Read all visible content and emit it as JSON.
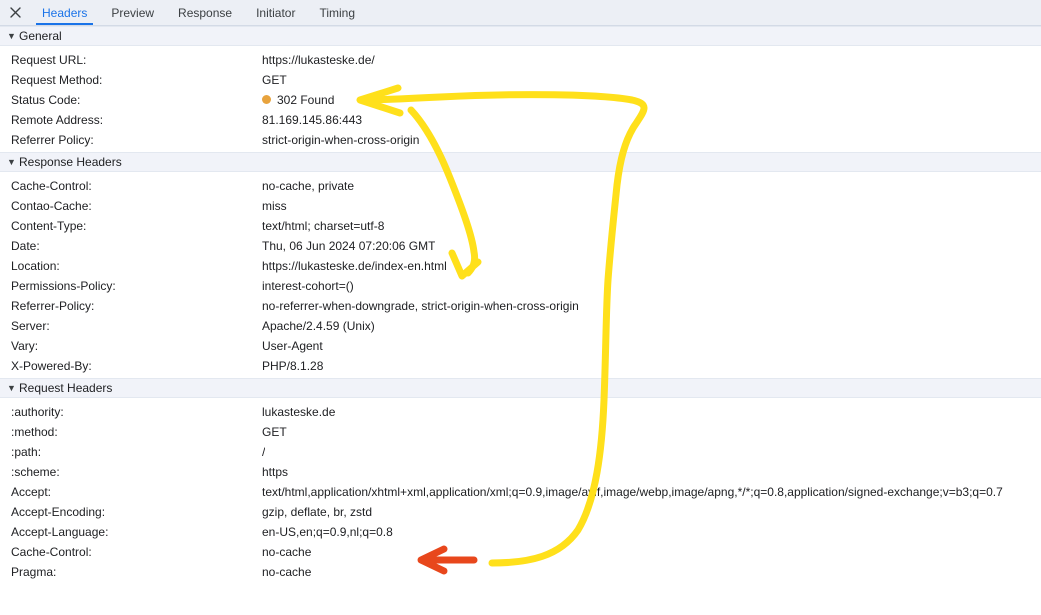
{
  "tabbar": {
    "close_icon": "close-icon",
    "tabs": [
      {
        "label": "Headers",
        "active": true
      },
      {
        "label": "Preview",
        "active": false
      },
      {
        "label": "Response",
        "active": false
      },
      {
        "label": "Initiator",
        "active": false
      },
      {
        "label": "Timing",
        "active": false
      }
    ]
  },
  "sections": [
    {
      "title": "General",
      "expanded": true,
      "caret": "▼",
      "rows": [
        {
          "key": "Request URL:",
          "value": "https://lukasteske.de/"
        },
        {
          "key": "Request Method:",
          "value": "GET"
        },
        {
          "key": "Status Code:",
          "value": "302 Found",
          "status_dot": true,
          "status_color": "#e8a33d"
        },
        {
          "key": "Remote Address:",
          "value": "81.169.145.86:443"
        },
        {
          "key": "Referrer Policy:",
          "value": "strict-origin-when-cross-origin"
        }
      ]
    },
    {
      "title": "Response Headers",
      "expanded": true,
      "caret": "▼",
      "rows": [
        {
          "key": "Cache-Control:",
          "value": "no-cache, private"
        },
        {
          "key": "Contao-Cache:",
          "value": "miss"
        },
        {
          "key": "Content-Type:",
          "value": "text/html; charset=utf-8"
        },
        {
          "key": "Date:",
          "value": "Thu, 06 Jun 2024 07:20:06 GMT"
        },
        {
          "key": "Location:",
          "value": "https://lukasteske.de/index-en.html"
        },
        {
          "key": "Permissions-Policy:",
          "value": "interest-cohort=()"
        },
        {
          "key": "Referrer-Policy:",
          "value": "no-referrer-when-downgrade, strict-origin-when-cross-origin"
        },
        {
          "key": "Server:",
          "value": "Apache/2.4.59 (Unix)"
        },
        {
          "key": "Vary:",
          "value": "User-Agent"
        },
        {
          "key": "X-Powered-By:",
          "value": "PHP/8.1.28"
        }
      ]
    },
    {
      "title": "Request Headers",
      "expanded": true,
      "caret": "▼",
      "rows": [
        {
          "key": ":authority:",
          "value": "lukasteske.de"
        },
        {
          "key": ":method:",
          "value": "GET"
        },
        {
          "key": ":path:",
          "value": "/"
        },
        {
          "key": ":scheme:",
          "value": "https"
        },
        {
          "key": "Accept:",
          "value": "text/html,application/xhtml+xml,application/xml;q=0.9,image/avif,image/webp,image/apng,*/*;q=0.8,application/signed-exchange;v=b3;q=0.7"
        },
        {
          "key": "Accept-Encoding:",
          "value": "gzip, deflate, br, zstd"
        },
        {
          "key": "Accept-Language:",
          "value": "en-US,en;q=0.9,nl;q=0.8"
        },
        {
          "key": "Cache-Control:",
          "value": "no-cache"
        },
        {
          "key": "Pragma:",
          "value": "no-cache"
        }
      ]
    }
  ],
  "annotations": {
    "yellow_color": "#FFE01B",
    "orange_color": "#E8471C",
    "yellow_arrow_label": "arrow-pointing-to-status-code",
    "yellow_arrow2_label": "arrow-pointing-to-location",
    "orange_arrow_label": "arrow-pointing-to-accept-language"
  }
}
